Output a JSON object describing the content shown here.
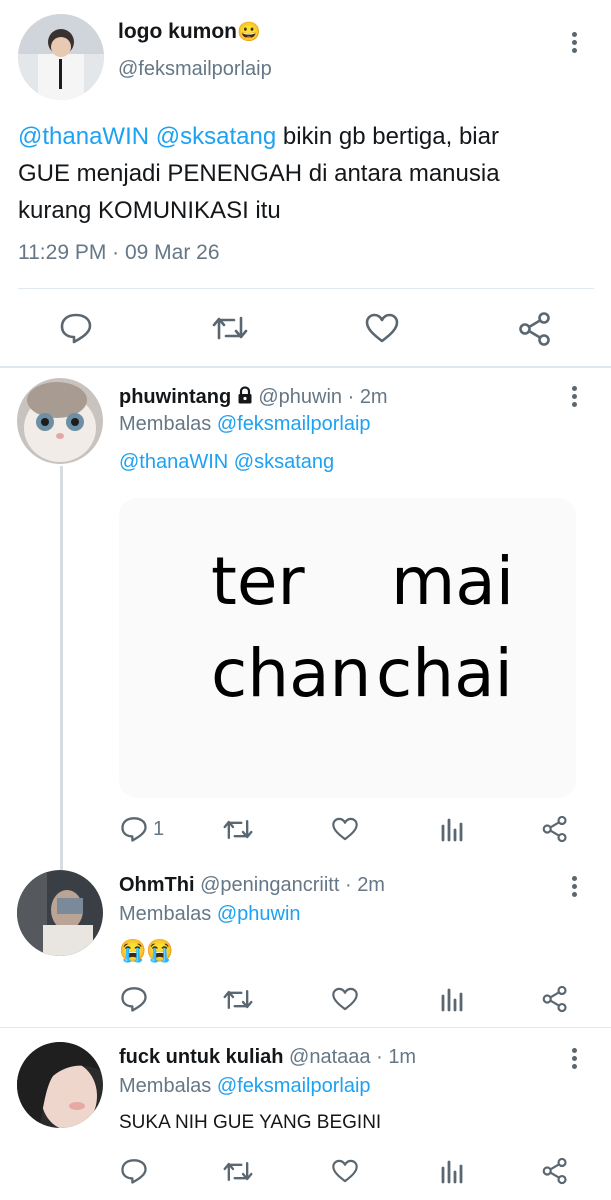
{
  "main_tweet": {
    "display_name": "logo kumon",
    "emoji": "😀",
    "handle": "@feksmailporlaip",
    "mention1": "@thanaWIN",
    "mention2": "@sksatang",
    "text_line1_rest": "bikin gb bertiga, biar",
    "text_line2": "GUE menjadi PENENGAH di antara manusia",
    "text_line3": "kurang KOMUNIKASI itu",
    "timestamp": "11:29 PM · 09 Mar 26"
  },
  "replies": [
    {
      "display_name": "phuwintang",
      "handle": "@phuwin",
      "time": "2m",
      "replying_label": "Membalas",
      "replying_to": "@feksmailporlaip",
      "mention1": "@thanaWIN",
      "mention2": "@sksatang",
      "image_text": [
        "ter",
        "mai",
        "chan",
        "chai"
      ],
      "reply_count": "1"
    },
    {
      "display_name": "OhmThi",
      "handle": "@peningancriitt",
      "time": "2m",
      "replying_label": "Membalas",
      "replying_to": "@phuwin",
      "text": "😭😭"
    },
    {
      "display_name": "fuck untuk kuliah",
      "handle": "@nataaa",
      "time": "1m",
      "replying_label": "Membalas",
      "replying_to": "@feksmailporlaip",
      "text": "SUKA NIH GUE YANG BEGINI"
    }
  ],
  "dot_sep": "·",
  "colors": {
    "link": "#1da1f2",
    "gray": "#657786",
    "icon": "#5b6770",
    "divider": "#e1e8ed"
  }
}
